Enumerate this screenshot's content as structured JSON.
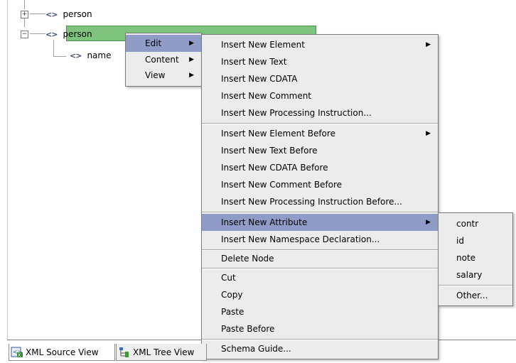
{
  "tree": {
    "nodes": [
      {
        "label": "person",
        "expander": "+"
      },
      {
        "label": "person",
        "expander": "−"
      },
      {
        "label": "name"
      }
    ],
    "node_icon": "<>"
  },
  "context_menu": {
    "items": [
      "Edit",
      "Content",
      "View"
    ]
  },
  "edit_submenu": {
    "items": [
      "Insert New Element",
      "Insert New Text",
      "Insert New CDATA",
      "Insert New Comment",
      "Insert New Processing Instruction...",
      "Insert New Element Before",
      "Insert New Text Before",
      "Insert New CDATA Before",
      "Insert New Comment Before",
      "Insert New Processing Instruction Before...",
      "Insert New Attribute",
      "Insert New Namespace Declaration...",
      "Delete Node",
      "Cut",
      "Copy",
      "Paste",
      "Paste Before",
      "Schema Guide..."
    ]
  },
  "attribute_submenu": {
    "items": [
      "contr",
      "id",
      "note",
      "salary",
      "Other..."
    ]
  },
  "tabs": [
    "XML Source View",
    "XML Tree View"
  ],
  "colors": {
    "selected_node": "#7ec47e",
    "menu_highlight": "#8e9cc7",
    "menu_bg": "#ececec"
  }
}
